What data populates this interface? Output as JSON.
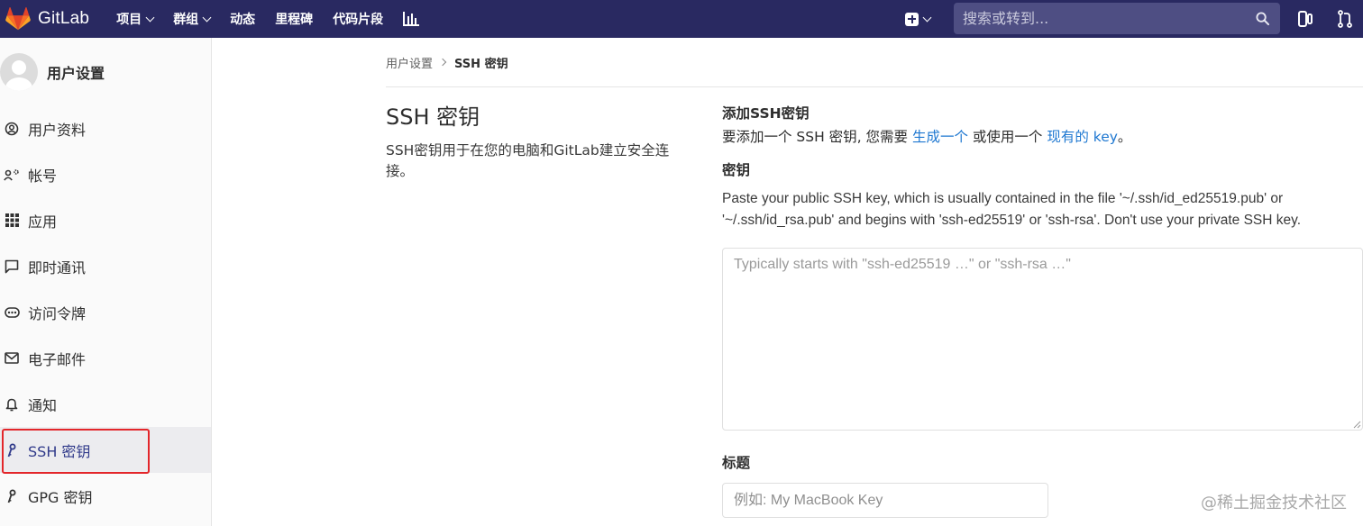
{
  "navbar": {
    "brand": "GitLab",
    "links": [
      {
        "label": "项目",
        "dropdown": true
      },
      {
        "label": "群组",
        "dropdown": true
      },
      {
        "label": "动态",
        "dropdown": false
      },
      {
        "label": "里程碑",
        "dropdown": false
      },
      {
        "label": "代码片段",
        "dropdown": false
      }
    ],
    "search_placeholder": "搜索或转到...",
    "bg_color": "#292961"
  },
  "sidebar": {
    "title": "用户设置",
    "items": [
      {
        "label": "用户资料",
        "icon": "profile-icon"
      },
      {
        "label": "帐号",
        "icon": "account-icon"
      },
      {
        "label": "应用",
        "icon": "applications-icon"
      },
      {
        "label": "即时通讯",
        "icon": "chat-icon"
      },
      {
        "label": "访问令牌",
        "icon": "token-icon"
      },
      {
        "label": "电子邮件",
        "icon": "mail-icon"
      },
      {
        "label": "通知",
        "icon": "bell-icon"
      },
      {
        "label": "SSH 密钥",
        "icon": "key-icon",
        "active": true
      },
      {
        "label": "GPG 密钥",
        "icon": "key-icon"
      }
    ]
  },
  "breadcrumb": {
    "parent": "用户设置",
    "current": "SSH 密钥"
  },
  "page": {
    "title": "SSH 密钥",
    "description": "SSH密钥用于在您的电脑和GitLab建立安全连接。"
  },
  "form": {
    "add_heading": "添加SSH密钥",
    "add_desc_prefix": "要添加一个 SSH 密钥, 您需要 ",
    "add_desc_link1": "生成一个",
    "add_desc_mid": " 或使用一个 ",
    "add_desc_link2": "现有的 key",
    "add_desc_suffix": "。",
    "key_label": "密钥",
    "key_help": "Paste your public SSH key, which is usually contained in the file '~/.ssh/id_ed25519.pub' or '~/.ssh/id_rsa.pub' and begins with 'ssh-ed25519' or 'ssh-rsa'. Don't use your private SSH key.",
    "key_placeholder": "Typically starts with \"ssh-ed25519 …\" or \"ssh-rsa …\"",
    "title_label": "标题",
    "title_placeholder": "例如: My MacBook Key"
  },
  "watermark": "@稀土掘金技术社区",
  "colors": {
    "link": "#1f78d1",
    "highlight_outline": "#e3262a"
  }
}
